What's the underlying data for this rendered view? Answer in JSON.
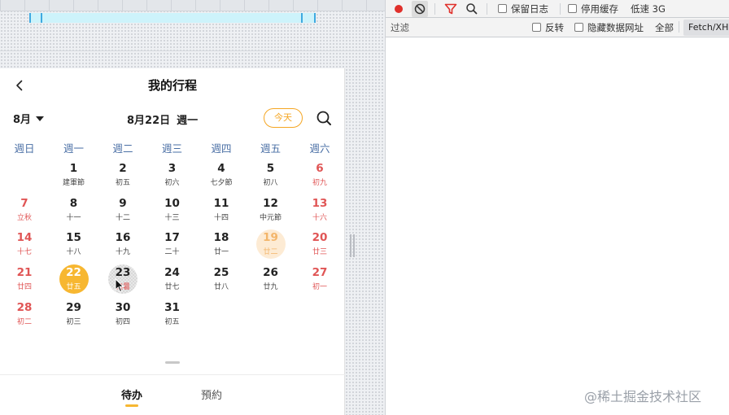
{
  "calendar": {
    "title": "我的行程",
    "month_label": "8月",
    "selected_date": "8月22日",
    "selected_weekday": "週一",
    "today_label": "今天",
    "weekdays": [
      "週日",
      "週一",
      "週二",
      "週三",
      "週四",
      "週五",
      "週六"
    ],
    "days": [
      {
        "day": "1",
        "lunar": "建軍節",
        "col": 1,
        "row": 0
      },
      {
        "day": "2",
        "lunar": "初五",
        "col": 2,
        "row": 0
      },
      {
        "day": "3",
        "lunar": "初六",
        "col": 3,
        "row": 0
      },
      {
        "day": "4",
        "lunar": "七夕節",
        "col": 4,
        "row": 0
      },
      {
        "day": "5",
        "lunar": "初八",
        "col": 5,
        "row": 0
      },
      {
        "day": "6",
        "lunar": "初九",
        "col": 6,
        "row": 0
      },
      {
        "day": "7",
        "lunar": "立秋",
        "col": 0,
        "row": 1,
        "holiday": true
      },
      {
        "day": "8",
        "lunar": "十一",
        "col": 1,
        "row": 1
      },
      {
        "day": "9",
        "lunar": "十二",
        "col": 2,
        "row": 1
      },
      {
        "day": "10",
        "lunar": "十三",
        "col": 3,
        "row": 1
      },
      {
        "day": "11",
        "lunar": "十四",
        "col": 4,
        "row": 1
      },
      {
        "day": "12",
        "lunar": "中元節",
        "col": 5,
        "row": 1
      },
      {
        "day": "13",
        "lunar": "十六",
        "col": 6,
        "row": 1
      },
      {
        "day": "14",
        "lunar": "十七",
        "col": 0,
        "row": 2
      },
      {
        "day": "15",
        "lunar": "十八",
        "col": 1,
        "row": 2
      },
      {
        "day": "16",
        "lunar": "十九",
        "col": 2,
        "row": 2
      },
      {
        "day": "17",
        "lunar": "二十",
        "col": 3,
        "row": 2
      },
      {
        "day": "18",
        "lunar": "廿一",
        "col": 4,
        "row": 2
      },
      {
        "day": "19",
        "lunar": "廿二",
        "col": 5,
        "row": 2,
        "state": "festival"
      },
      {
        "day": "20",
        "lunar": "廿三",
        "col": 6,
        "row": 2
      },
      {
        "day": "21",
        "lunar": "廿四",
        "col": 0,
        "row": 3
      },
      {
        "day": "22",
        "lunar": "廿五",
        "col": 1,
        "row": 3,
        "state": "today"
      },
      {
        "day": "23",
        "lunar": "處暑",
        "col": 2,
        "row": 3,
        "state": "hover",
        "holiday": true
      },
      {
        "day": "24",
        "lunar": "廿七",
        "col": 3,
        "row": 3
      },
      {
        "day": "25",
        "lunar": "廿八",
        "col": 4,
        "row": 3
      },
      {
        "day": "26",
        "lunar": "廿九",
        "col": 5,
        "row": 3
      },
      {
        "day": "27",
        "lunar": "初一",
        "col": 6,
        "row": 3
      },
      {
        "day": "28",
        "lunar": "初二",
        "col": 0,
        "row": 4
      },
      {
        "day": "29",
        "lunar": "初三",
        "col": 1,
        "row": 4
      },
      {
        "day": "30",
        "lunar": "初四",
        "col": 2,
        "row": 4
      },
      {
        "day": "31",
        "lunar": "初五",
        "col": 3,
        "row": 4
      }
    ],
    "tabs": [
      {
        "label": "待办",
        "active": true
      },
      {
        "label": "預約",
        "active": false
      }
    ],
    "colors": {
      "accent": "#f7b731",
      "weekend": "#e05555",
      "weekday_header": "#4a6fa5"
    }
  },
  "devtools": {
    "preserve_log_label": "保留日志",
    "disable_cache_label": "停用缓存",
    "throttle_label": "低速 3G",
    "filter_placeholder": "过滤",
    "invert_label": "反转",
    "hide_data_urls_label": "隐藏数据网址",
    "all_label": "全部",
    "fetch_xhr_label": "Fetch/XHR",
    "colors": {
      "record": "#e0302b",
      "filter_active": "#e0302b"
    }
  },
  "watermark": "@稀土掘金技术社区"
}
